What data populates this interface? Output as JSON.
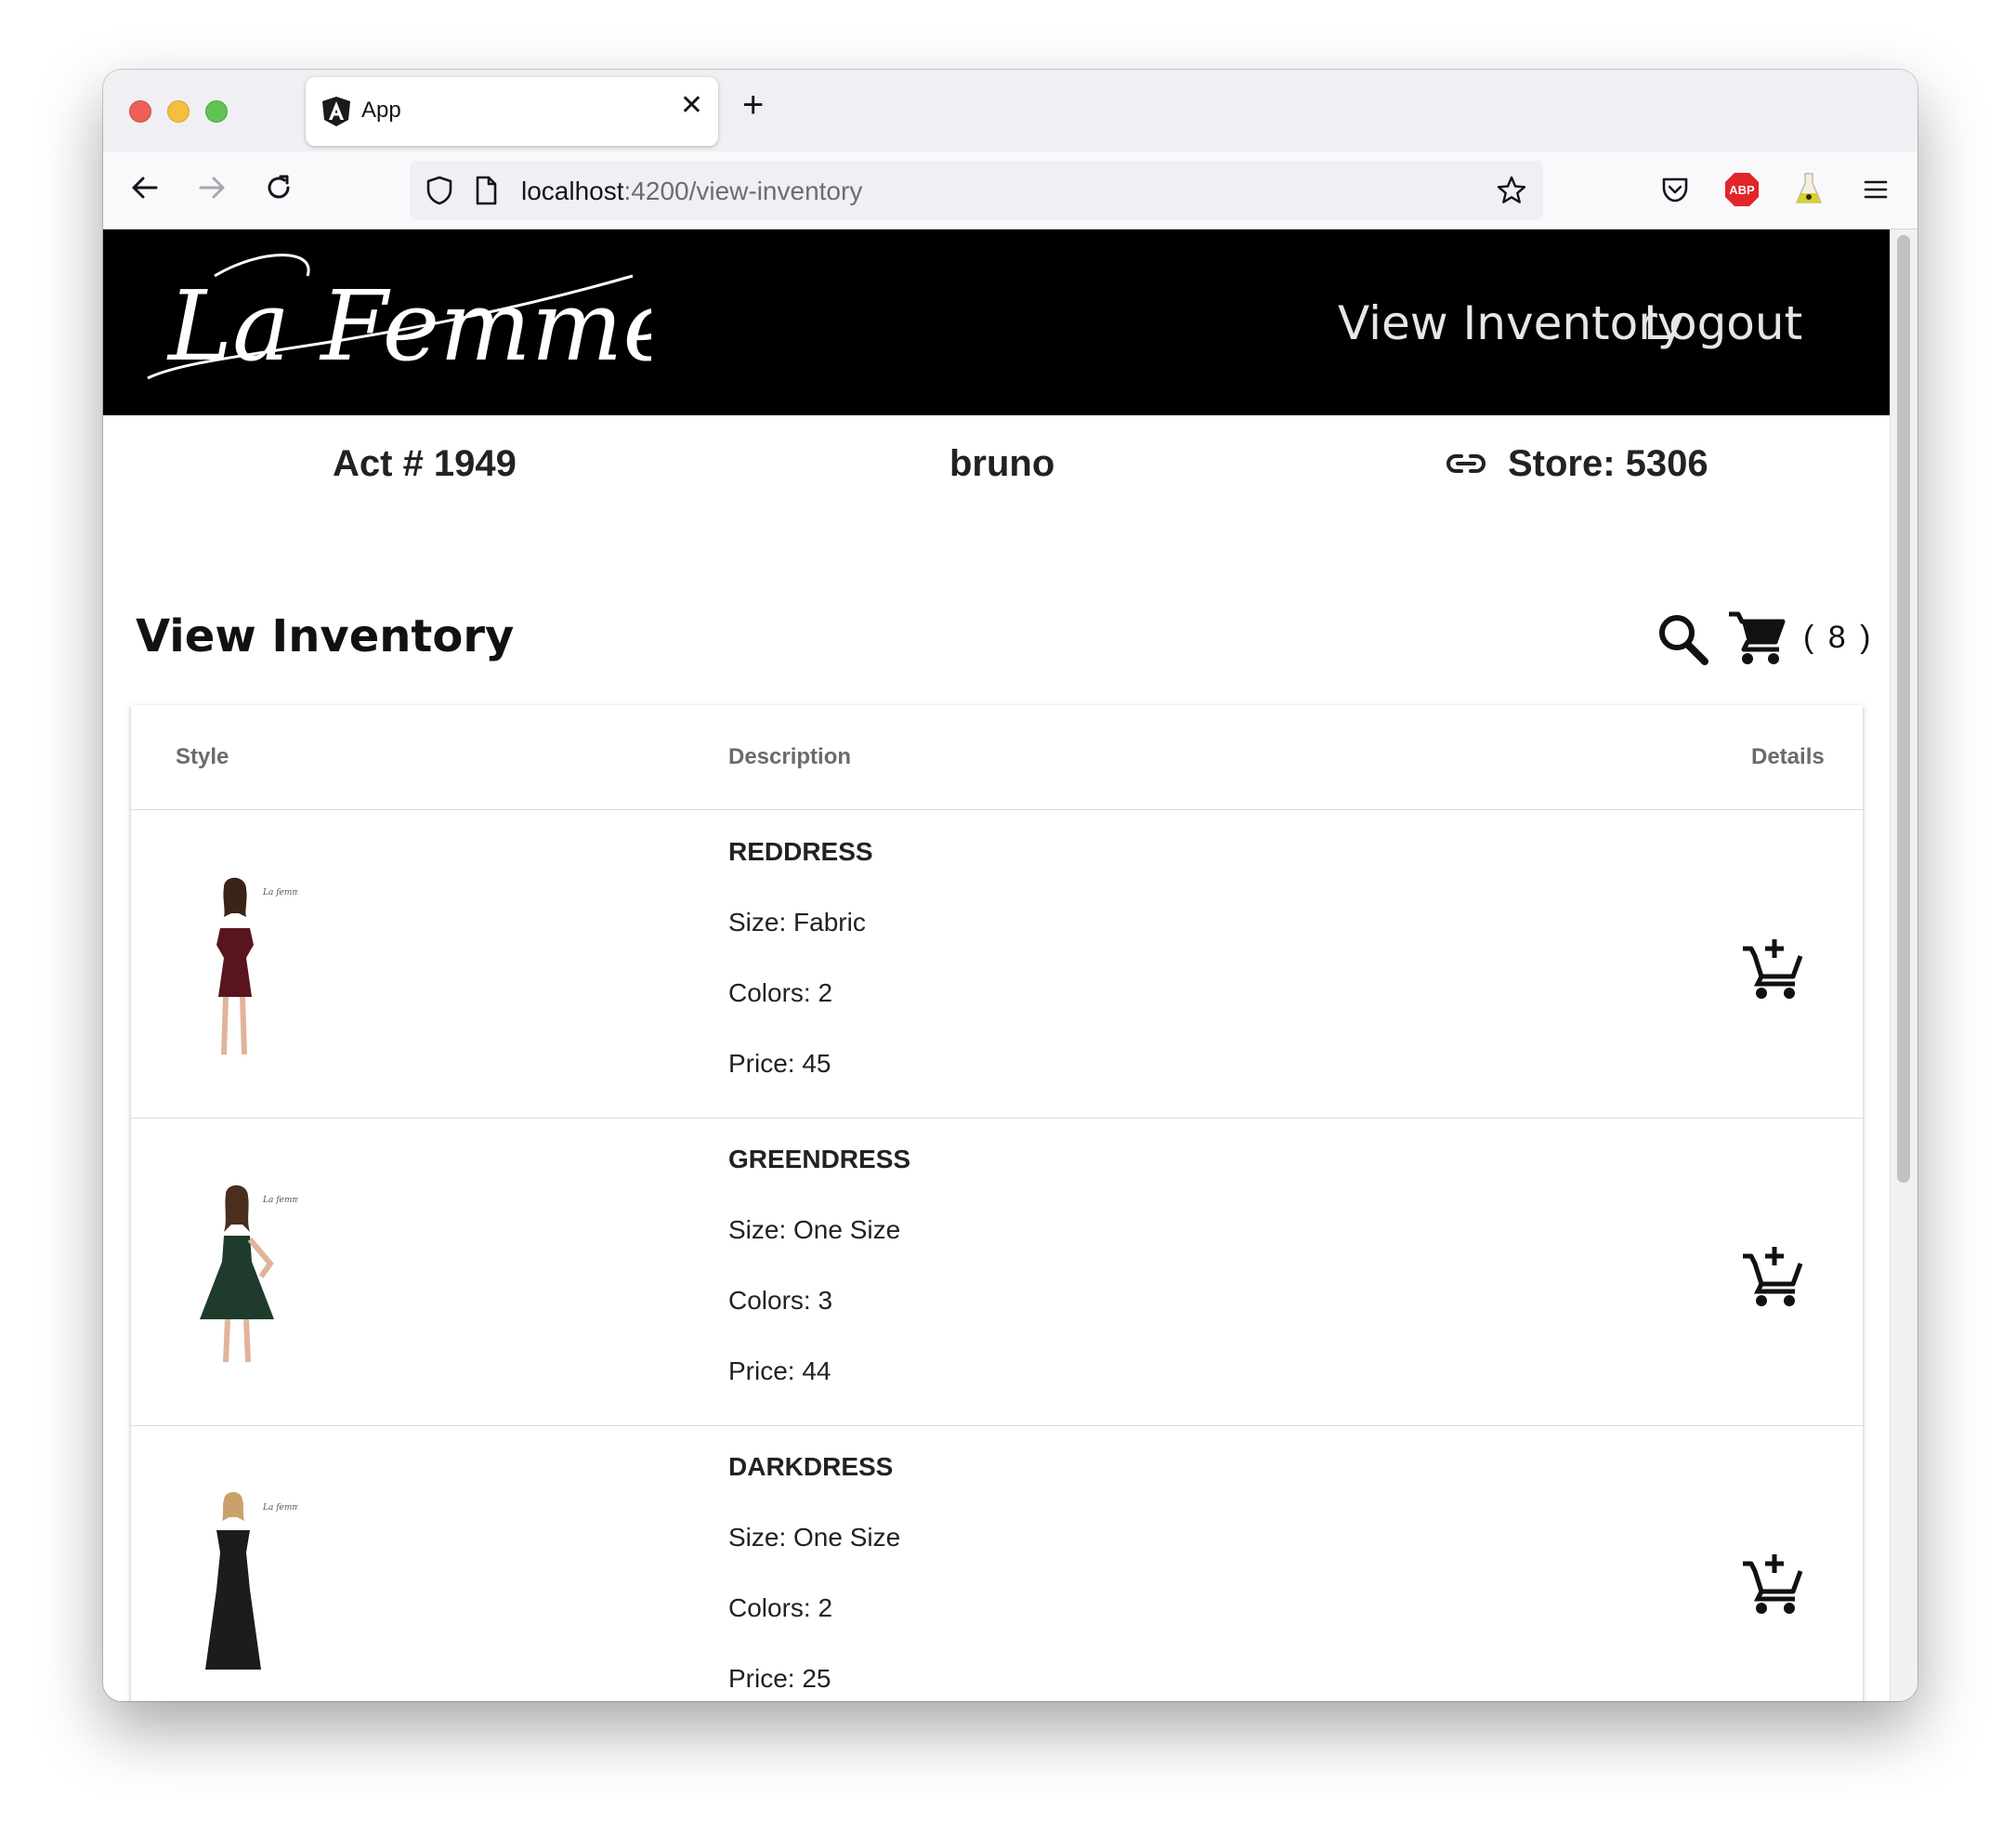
{
  "browser": {
    "tab_title": "App",
    "url_host": "localhost",
    "url_path": ":4200/view-inventory"
  },
  "header": {
    "logo_text": "La Femme",
    "nav": [
      "View Inventory",
      "Logout"
    ]
  },
  "info": {
    "account": "Act # 1949",
    "user": "bruno",
    "store": "Store: 5306"
  },
  "page": {
    "title": "View Inventory",
    "cart_count": "( 8 )"
  },
  "table": {
    "columns": [
      "Style",
      "Description",
      "Details"
    ],
    "rows": [
      {
        "name": "REDDRESS",
        "size": "Size: Fabric",
        "colors": "Colors: 2",
        "price": "Price: 45",
        "dress_color": "#5a1420"
      },
      {
        "name": "GREENDRESS",
        "size": "Size: One Size",
        "colors": "Colors: 3",
        "price": "Price: 44",
        "dress_color": "#1f3b2c"
      },
      {
        "name": "DARKDRESS",
        "size": "Size: One Size",
        "colors": "Colors: 2",
        "price": "Price: 25",
        "dress_color": "#1c1c1c"
      }
    ]
  },
  "colors": {
    "header_bg": "#000000",
    "accent_text": "#e6e6e6"
  }
}
